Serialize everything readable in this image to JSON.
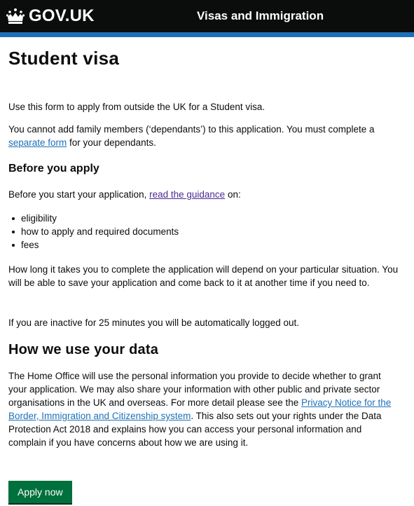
{
  "header": {
    "logo_text": "GOV.UK",
    "service_name": "Visas and Immigration"
  },
  "page": {
    "title": "Student visa",
    "intro": "Use this form to apply from outside the UK for a Student visa.",
    "dependants": {
      "before": "You cannot add family members (‘dependants’) to this application. You must complete a ",
      "link": "separate form",
      "after": " for your dependants."
    }
  },
  "before_you_apply": {
    "heading": "Before you apply",
    "lead_before": "Before you start your application, ",
    "lead_link": "read the guidance",
    "lead_after": " on:",
    "bullets": [
      "eligibility",
      "how to apply and required documents",
      "fees"
    ],
    "timing": "How long it takes you to complete the application will depend on your particular situation. You will be able to save your application and come back to it at another time if you need to.",
    "inactive": "If you are inactive for 25 minutes you will be automatically logged out."
  },
  "data_use": {
    "heading": "How we use your data",
    "text_before": "The Home Office will use the personal information you provide to decide whether to grant your application. We may also share your information with other public and private sector organisations in the UK and overseas. For more detail please see the ",
    "link": "Privacy Notice for the Border, Immigration and Citizenship system",
    "text_after": ". This also sets out your rights under the Data Protection Act 2018 and explains how you can access your personal information and complain if you have concerns about how we are using it."
  },
  "actions": {
    "apply_label": "Apply now"
  },
  "colors": {
    "header_bg": "#0b0c0c",
    "header_bar": "#1d70b8",
    "link": "#1d70b8",
    "visited_link": "#4c2c92",
    "button": "#00703c"
  },
  "icons": {
    "logo": "crown-icon"
  }
}
